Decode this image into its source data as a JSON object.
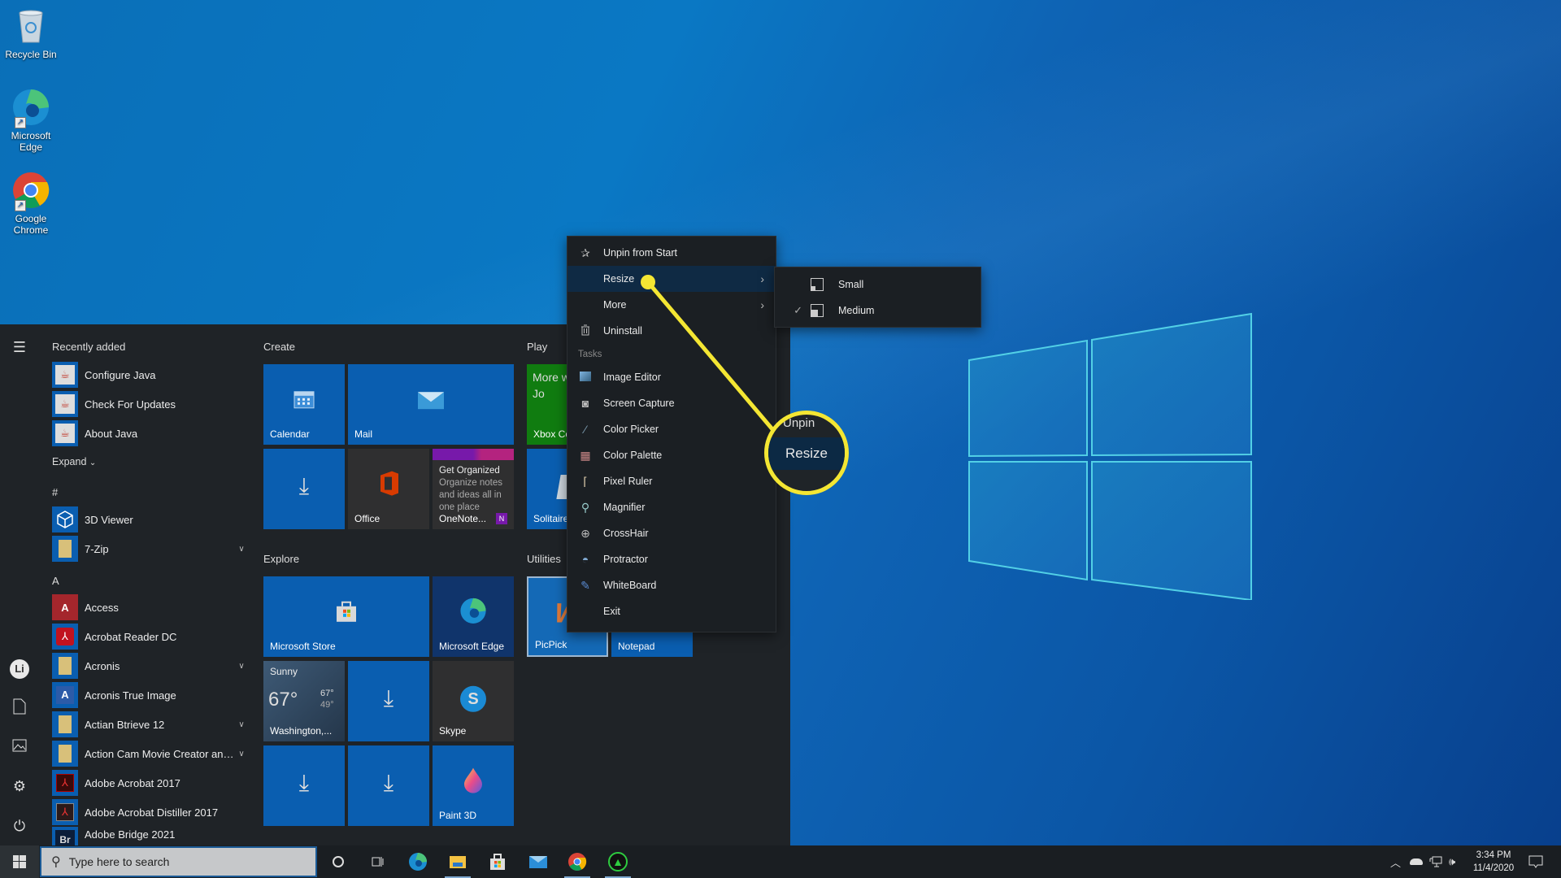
{
  "desktop": {
    "icons": [
      {
        "label": "Recycle Bin",
        "icon": "recycle-bin-icon"
      },
      {
        "label": "Microsoft Edge",
        "icon": "edge-icon"
      },
      {
        "label": "Google Chrome",
        "icon": "chrome-icon"
      }
    ]
  },
  "start_menu": {
    "rail_icons": [
      "hamburger-menu-icon",
      "user-avatar-icon",
      "documents-icon",
      "pictures-icon",
      "settings-icon",
      "power-icon"
    ],
    "recently_added_heading": "Recently added",
    "recently_added": [
      {
        "label": "Configure Java"
      },
      {
        "label": "Check For Updates"
      },
      {
        "label": "About Java"
      }
    ],
    "expand_label": "Expand",
    "sections": [
      {
        "letter": "#",
        "apps": [
          {
            "label": "3D Viewer",
            "expandable": false
          },
          {
            "label": "7-Zip",
            "expandable": true
          }
        ]
      },
      {
        "letter": "A",
        "apps": [
          {
            "label": "Access",
            "expandable": false
          },
          {
            "label": "Acrobat Reader DC",
            "expandable": false
          },
          {
            "label": "Acronis",
            "expandable": true
          },
          {
            "label": "Acronis True Image",
            "expandable": false
          },
          {
            "label": "Actian Btrieve 12",
            "expandable": true
          },
          {
            "label": "Action Cam Movie Creator and P...",
            "expandable": true
          },
          {
            "label": "Adobe Acrobat 2017",
            "expandable": false
          },
          {
            "label": "Adobe Acrobat Distiller 2017",
            "expandable": false
          },
          {
            "label": "Adobe Bridge 2021",
            "expandable": false
          }
        ]
      }
    ],
    "groups": {
      "create": {
        "title": "Create",
        "tiles": [
          {
            "label": "Calendar"
          },
          {
            "label": "Mail"
          },
          {
            "label": ""
          },
          {
            "label": "Office"
          },
          {
            "label": "OneNote...",
            "headline": "Get Organized",
            "body": "Organize notes and ideas all in one place"
          }
        ]
      },
      "play": {
        "title": "Play",
        "tiles": [
          {
            "label": "Xbox Co",
            "body": "More w play. Jo"
          },
          {
            "label": "Solitaire"
          }
        ]
      },
      "explore": {
        "title": "Explore",
        "tiles": [
          {
            "label": "Microsoft Store"
          },
          {
            "label": "Microsoft Edge"
          },
          {
            "label": "Washington,...",
            "condition": "Sunny",
            "temp": "67°",
            "high": "67°",
            "low": "49°"
          },
          {
            "label": ""
          },
          {
            "label": "Skype"
          },
          {
            "label": ""
          },
          {
            "label": ""
          },
          {
            "label": "Paint 3D"
          }
        ]
      },
      "utilities": {
        "title": "Utilities",
        "tiles": [
          {
            "label": "PicPick",
            "selected": true
          },
          {
            "label": "Notepad"
          }
        ]
      }
    }
  },
  "context_menu": {
    "items": [
      {
        "label": "Unpin from Start",
        "icon": "unpin-icon"
      },
      {
        "label": "Resize",
        "submenu": true,
        "highlighted": true
      },
      {
        "label": "More",
        "submenu": true
      },
      {
        "label": "Uninstall",
        "icon": "trash-icon"
      }
    ],
    "tasks_heading": "Tasks",
    "tasks": [
      {
        "label": "Image Editor",
        "icon": "image-editor-icon"
      },
      {
        "label": "Screen Capture",
        "icon": "camera-icon"
      },
      {
        "label": "Color Picker",
        "icon": "eyedropper-icon"
      },
      {
        "label": "Color Palette",
        "icon": "palette-grid-icon"
      },
      {
        "label": "Pixel Ruler",
        "icon": "ruler-icon"
      },
      {
        "label": "Magnifier",
        "icon": "magnifier-icon"
      },
      {
        "label": "CrossHair",
        "icon": "crosshair-icon"
      },
      {
        "label": "Protractor",
        "icon": "protractor-icon"
      },
      {
        "label": "WhiteBoard",
        "icon": "pen-icon"
      },
      {
        "label": "Exit"
      }
    ],
    "resize_submenu": [
      {
        "label": "Small",
        "checked": false
      },
      {
        "label": "Medium",
        "checked": true
      }
    ]
  },
  "callout": {
    "label": "Resize",
    "partial_above": "Unpin",
    "color": "#f4e633"
  },
  "taskbar": {
    "search_placeholder": "Type here to search",
    "pinned": [
      "cortana-icon",
      "task-view-icon",
      "edge-icon",
      "file-explorer-icon",
      "store-icon",
      "mail-icon",
      "chrome-icon",
      "green-app-icon"
    ],
    "tray_icons": [
      "show-hidden-icons-chevron",
      "onedrive-icon",
      "network-icon",
      "volume-icon"
    ],
    "time": "3:34 PM",
    "date": "11/4/2020",
    "notification_icon": "action-center-icon"
  },
  "colors": {
    "accent": "#0a5eb0",
    "start_bg": "#1f2327",
    "menu_bg": "#1b1f23",
    "highlight": "#0f2a44",
    "callout": "#f4e633"
  }
}
